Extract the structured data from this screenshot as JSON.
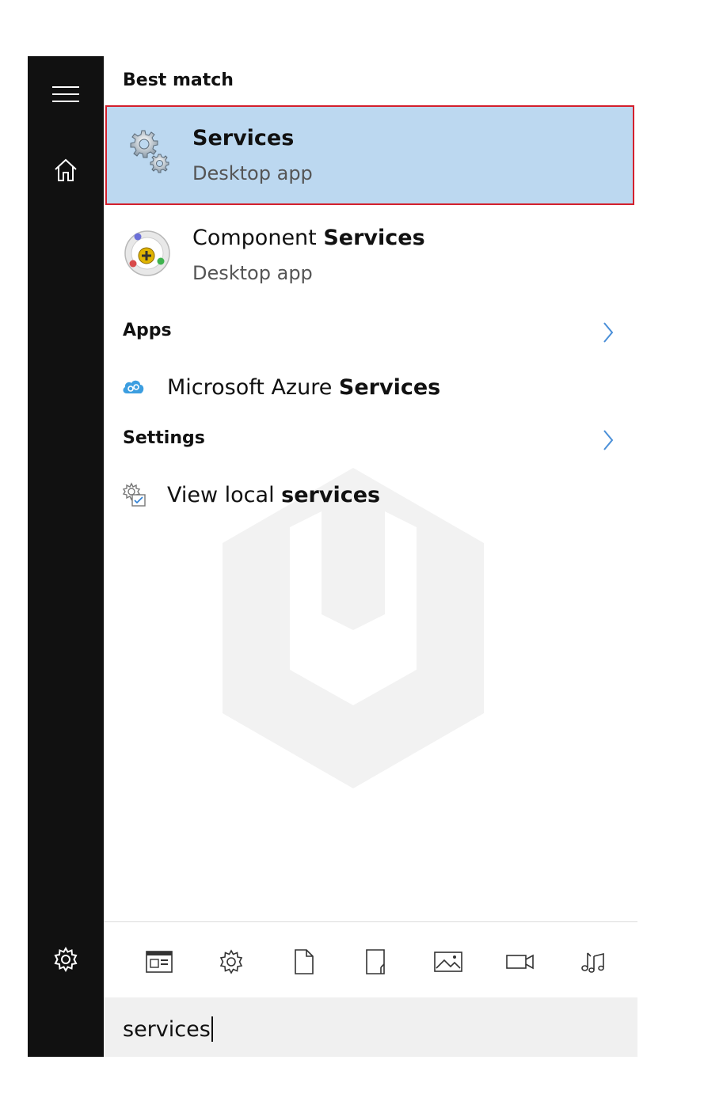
{
  "sidebar": {
    "menu_icon": "hamburger-icon",
    "home_icon": "home-icon",
    "settings_icon": "gear-icon",
    "background": "#111111"
  },
  "best_match": {
    "header": "Best match",
    "item": {
      "title": "Services",
      "subtitle": "Desktop app",
      "icon": "services-gears-icon",
      "highlight_color": "#bcd8f0",
      "border_color": "#d31f2c"
    }
  },
  "component_services": {
    "title_prefix": "Component ",
    "title_bold": "Services",
    "subtitle": "Desktop app",
    "icon": "component-services-icon"
  },
  "apps": {
    "header": "Apps",
    "item": {
      "prefix": "Microsoft Azure ",
      "bold": "Services",
      "icon": "azure-cloud-icon"
    }
  },
  "settings": {
    "header": "Settings",
    "item": {
      "prefix": "View local ",
      "bold": "services",
      "icon": "local-services-icon"
    }
  },
  "filters": [
    {
      "name": "apps-filter-icon"
    },
    {
      "name": "settings-filter-icon"
    },
    {
      "name": "documents-filter-icon"
    },
    {
      "name": "folders-filter-icon"
    },
    {
      "name": "photos-filter-icon"
    },
    {
      "name": "videos-filter-icon"
    },
    {
      "name": "music-filter-icon"
    }
  ],
  "search": {
    "value": "services"
  },
  "accent": "#4a8fd8"
}
